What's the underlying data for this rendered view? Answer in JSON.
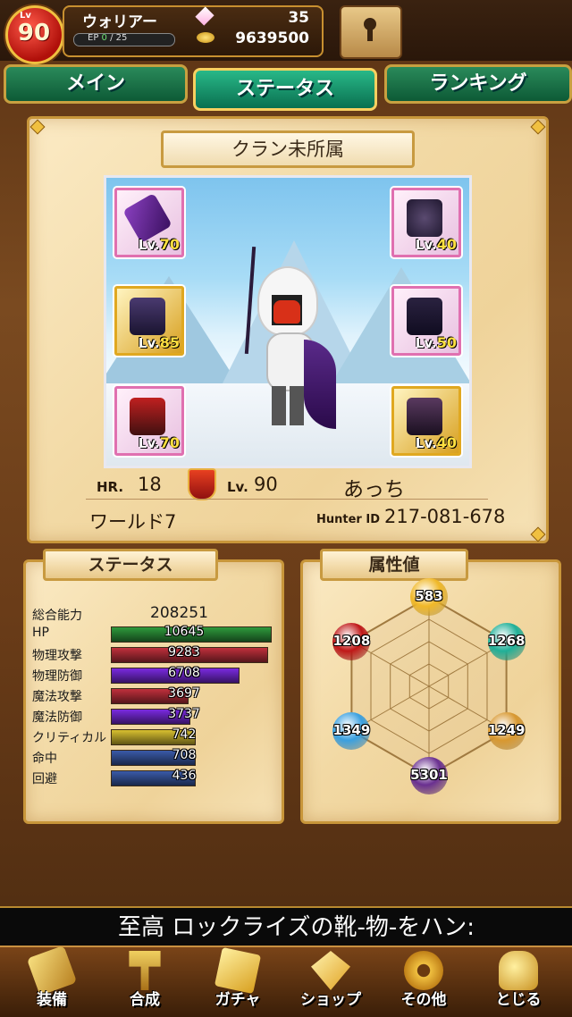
{
  "header": {
    "level_label": "Lv",
    "level": "90",
    "job": "ウォリアー",
    "ep_label": "EP",
    "ep_current": "0",
    "ep_max": "/ 25",
    "gems": "35",
    "coins": "9639500"
  },
  "tabs": [
    {
      "label": "メイン",
      "active": false
    },
    {
      "label": "ステータス",
      "active": true
    },
    {
      "label": "ランキング",
      "active": false
    }
  ],
  "profile": {
    "clan": "クラン未所属",
    "equipment": [
      {
        "level_label": "Lv.",
        "level": "70",
        "frame": "pink",
        "icon": "feather-staff-icon"
      },
      {
        "level_label": "Lv.",
        "level": "40",
        "frame": "pink",
        "icon": "horned-helmet-icon"
      },
      {
        "level_label": "Lv.",
        "level": "85",
        "frame": "gold",
        "icon": "chest-armor-icon"
      },
      {
        "level_label": "Lv.",
        "level": "50",
        "frame": "pink",
        "icon": "gauntlet-icon"
      },
      {
        "level_label": "Lv.",
        "level": "70",
        "frame": "pink",
        "icon": "leg-armor-icon"
      },
      {
        "level_label": "Lv.",
        "level": "40",
        "frame": "gold",
        "icon": "boots-icon"
      }
    ],
    "hr_label": "HR.",
    "hr": "18",
    "lv_label": "Lv.",
    "lv": "90",
    "name": "あっち",
    "world": "ワールド7",
    "hunter_id_label": "Hunter ID",
    "hunter_id": "217-081-678"
  },
  "status": {
    "title": "ステータス",
    "total_label": "総合能力",
    "total": "208251",
    "rows": [
      {
        "label": "HP",
        "value": "10645",
        "fill": 1.0,
        "color": "#2e9a3c"
      },
      {
        "label": "物理攻撃",
        "value": "9283",
        "fill": 0.98,
        "color": "#c0303c"
      },
      {
        "label": "物理防御",
        "value": "6708",
        "fill": 0.8,
        "color": "#7a2ae0"
      },
      {
        "label": "魔法攻撃",
        "value": "3697",
        "fill": 0.48,
        "color": "#c0303c"
      },
      {
        "label": "魔法防御",
        "value": "3737",
        "fill": 0.49,
        "color": "#7a2ae0"
      },
      {
        "label": "クリティカル",
        "value": "742",
        "fill": 0.52,
        "color": "#d8c030"
      },
      {
        "label": "命中",
        "value": "708",
        "fill": 0.52,
        "color": "#3a5aa8"
      },
      {
        "label": "回避",
        "value": "436",
        "fill": 0.52,
        "color": "#3a5aa8"
      }
    ]
  },
  "attributes": {
    "title": "属性値",
    "values": [
      {
        "element": "light",
        "value": "583",
        "color": "#f0b828"
      },
      {
        "element": "water",
        "value": "1268",
        "color": "#20b098"
      },
      {
        "element": "earth",
        "value": "1249",
        "color": "#d89830"
      },
      {
        "element": "dark",
        "value": "5301",
        "color": "#6a3090"
      },
      {
        "element": "ice",
        "value": "1349",
        "color": "#3aa0e0"
      },
      {
        "element": "fire",
        "value": "1208",
        "color": "#c01818"
      }
    ]
  },
  "ticker": {
    "text": "至高 ロックライズの靴-物-をハン:"
  },
  "nav": [
    {
      "label": "装備",
      "icon": "equip-icon"
    },
    {
      "label": "合成",
      "icon": "hammer-icon"
    },
    {
      "label": "ガチャ",
      "icon": "gacha-cards-icon"
    },
    {
      "label": "ショップ",
      "icon": "crystal-icon"
    },
    {
      "label": "その他",
      "icon": "gear-icon"
    },
    {
      "label": "とじる",
      "icon": "close-gold-icon"
    }
  ]
}
